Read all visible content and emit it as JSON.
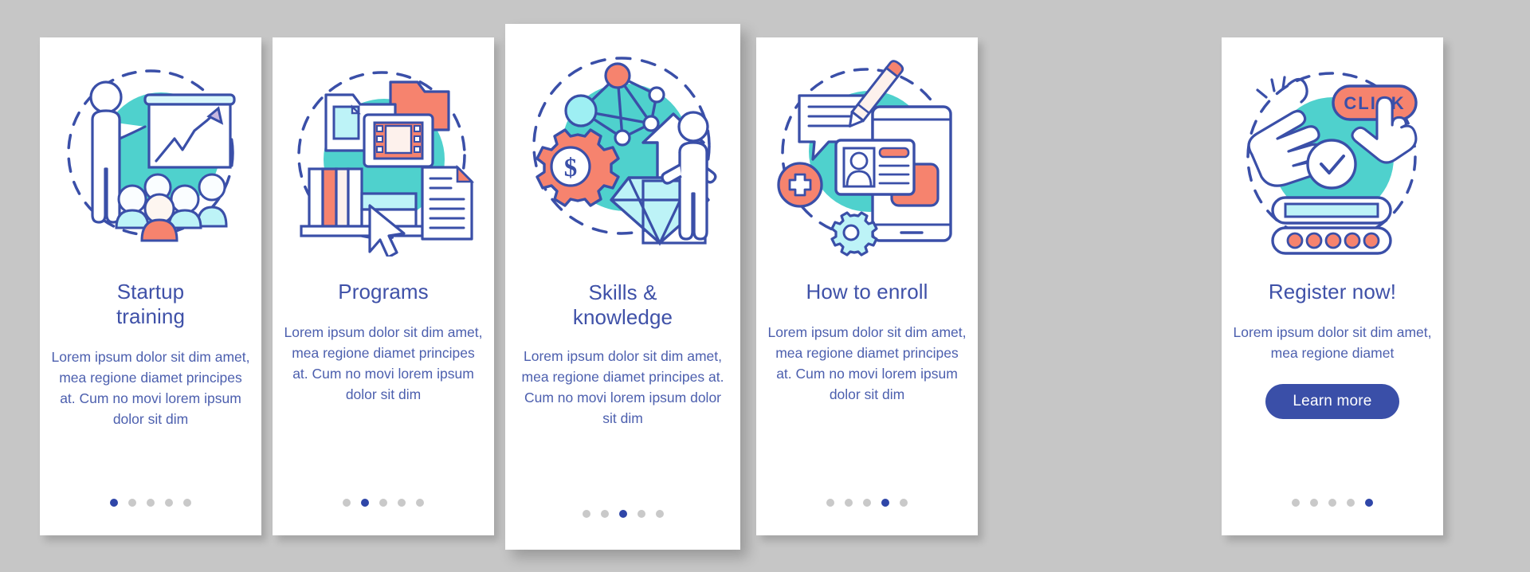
{
  "page": {
    "background_color": "#c6c6c6",
    "card_background": "#ffffff",
    "title_color": "#3f51a8",
    "body_color": "#4c5fae",
    "accent_blue": "#2f46a8",
    "accent_teal": "#4fd1cd",
    "accent_coral": "#f6836e",
    "outline_color": "#3a4fa8",
    "dot_inactive_color": "#c9c9c9"
  },
  "cards": [
    {
      "id": "startup-training",
      "title": "Startup\ntraining",
      "title_lines": [
        "Startup",
        "training"
      ],
      "body": "Lorem ipsum dolor sit dim amet, mea regione diamet principes at. Cum no movi lorem ipsum dolor sit dim",
      "illustration": "presenter-chart-audience-icon",
      "dots_total": 5,
      "dots_active_index": 0,
      "has_button": false
    },
    {
      "id": "programs",
      "title": "Programs",
      "title_lines": [
        "Programs"
      ],
      "body": "Lorem ipsum dolor sit dim amet, mea regione diamet principes at. Cum no movi lorem ipsum dolor sit dim",
      "illustration": "folders-media-books-document-icon",
      "dots_total": 5,
      "dots_active_index": 1,
      "has_button": false
    },
    {
      "id": "skills-knowledge",
      "title": "Skills &\nknowledge",
      "title_lines": [
        "Skills &",
        "knowledge"
      ],
      "body": "Lorem ipsum dolor sit dim amet, mea regione diamet principes at. Cum no movi lorem ipsum dolor sit dim",
      "illustration": "network-gear-diamond-person-icon",
      "dots_total": 5,
      "dots_active_index": 2,
      "has_button": false
    },
    {
      "id": "how-to-enroll",
      "title": "How to enroll",
      "title_lines": [
        "How to enroll"
      ],
      "body": "Lorem ipsum dolor sit dim amet, mea regione diamet principes at. Cum no movi lorem ipsum dolor sit dim",
      "illustration": "tablet-id-card-pencil-icon",
      "dots_total": 5,
      "dots_active_index": 3,
      "has_button": false
    },
    {
      "id": "register-now",
      "title": "Register now!",
      "title_lines": [
        "Register now!"
      ],
      "body": "Lorem ipsum dolor sit dim amet, mea regione diamet",
      "illustration": "hands-click-button-form-icon",
      "button_label": "Learn more",
      "dots_total": 5,
      "dots_active_index": 4,
      "has_button": true
    }
  ],
  "illustration_labels": {
    "click_button": "CLICK",
    "dollar_sign": "$"
  }
}
